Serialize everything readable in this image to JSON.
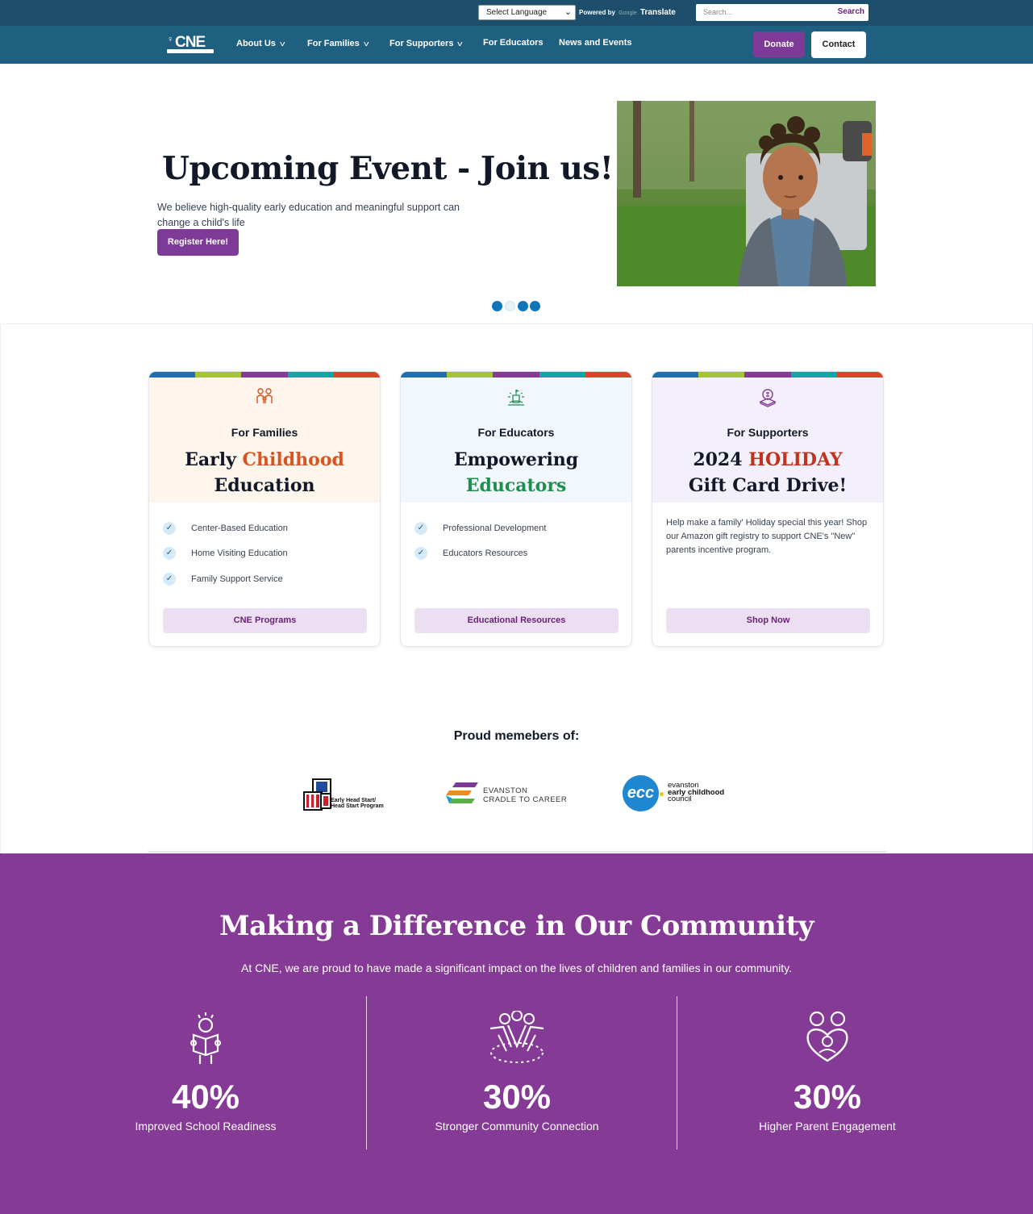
{
  "utility": {
    "language_label": "Select Language",
    "powered_by": "Powered by",
    "google": "Google",
    "translate": "Translate",
    "search_placeholder": "Search...",
    "search_button": "Search"
  },
  "nav": {
    "logo_text": "CNE",
    "items": [
      {
        "label": "About Us",
        "dropdown": true
      },
      {
        "label": "For Families",
        "dropdown": true
      },
      {
        "label": "For Supporters",
        "dropdown": true
      },
      {
        "label": "For Educators",
        "dropdown": false
      },
      {
        "label": "News and Events",
        "dropdown": false
      }
    ],
    "donate": "Donate",
    "contact": "Contact"
  },
  "hero": {
    "title": "Upcoming Event - Join us!",
    "text": "We believe high-quality early education and meaningful support can change a child's life",
    "button": "Register Here!",
    "slides": 4,
    "active_slide": 2
  },
  "cards": [
    {
      "icon": "family-icon",
      "kicker": "For Families",
      "headline_a": "Early ",
      "headline_b": "Childhood",
      "headline_c": "Education",
      "items": [
        "Center-Based Education",
        "Home Visiting Education",
        "Family Support Service"
      ],
      "cta": "CNE Programs"
    },
    {
      "icon": "school-icon",
      "kicker": "For Educators",
      "headline_a": "Empowering",
      "headline_b": "Educators",
      "items": [
        "Professional Development",
        "Educators Resources"
      ],
      "cta": "Educational Resources"
    },
    {
      "icon": "donation-icon",
      "kicker": "For Supporters",
      "headline_a": "2024 ",
      "headline_b": "HOLIDAY",
      "headline_c": "Gift Card Drive!",
      "desc": "Help make a family' Holiday special this year! Shop our Amazon gift registry to support CNE's \"New\" parents incentive program.",
      "cta": "Shop Now"
    }
  ],
  "members": {
    "title": "Proud memebers of:",
    "logos": [
      {
        "line1": "Early Head Start/",
        "line2": "Head Start Program"
      },
      {
        "line1": "EVANSTON",
        "line2": "CRADLE TO CAREER"
      },
      {
        "mark": "ecc",
        "line1": "evanston",
        "line2": "early childhood",
        "line3": "council"
      }
    ]
  },
  "impact": {
    "title": "Making a Difference in Our Community",
    "subtitle": "At CNE, we are proud to have made a significant impact on the lives of children and families in our community.",
    "stats": [
      {
        "icon": "child-reading-icon",
        "value": "40%",
        "label": "Improved School Readiness"
      },
      {
        "icon": "community-hands-icon",
        "value": "30%",
        "label": "Stronger Community Connection"
      },
      {
        "icon": "parent-hug-icon",
        "value": "30%",
        "label": "Higher Parent Engagement"
      }
    ]
  },
  "colors": {
    "topbar": "#1d4e6b",
    "navbar": "#1f5f80",
    "purple": "#853a95",
    "stripe": [
      "#1f6fb0",
      "#a5c23b",
      "#853a95",
      "#17a2a8",
      "#d9452b"
    ],
    "families_accent": "#d9541e",
    "educators_accent": "#1f8f4e",
    "supporters_accent": "#c0331c"
  }
}
